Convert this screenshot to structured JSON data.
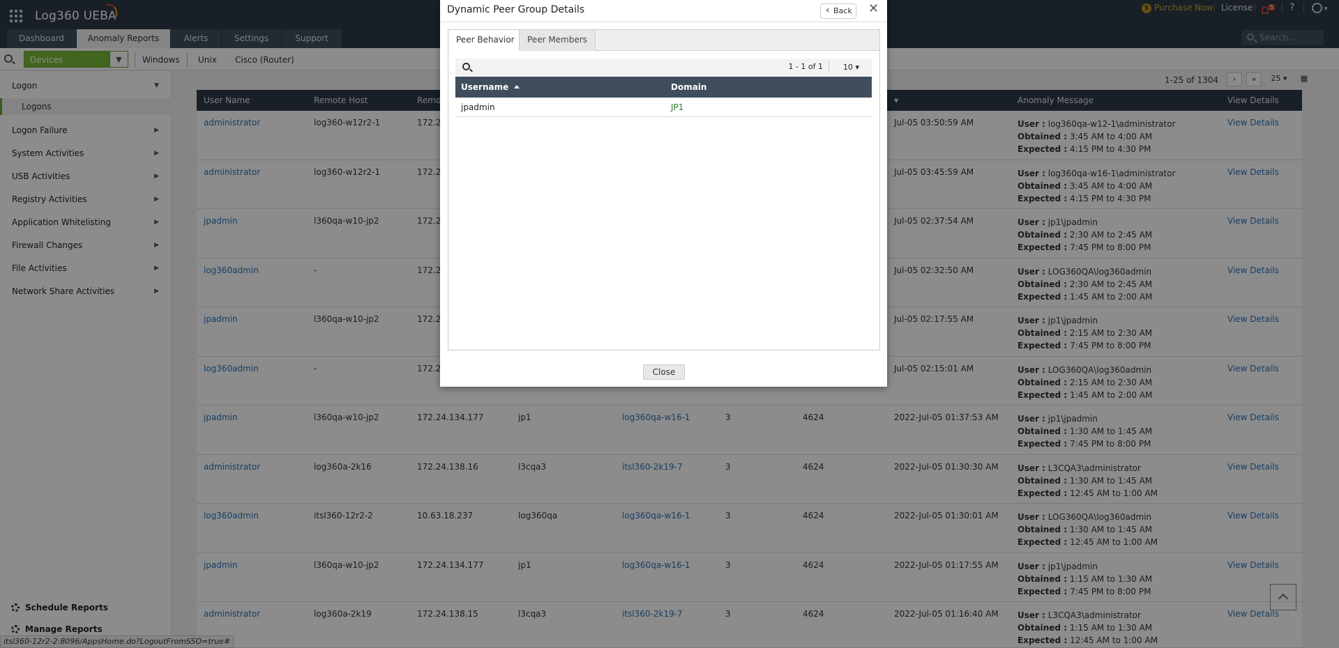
{
  "topbar": {
    "logo": "Log360 UEBA",
    "purchase": "Purchase Now",
    "license": "License",
    "notif_count": "5",
    "help": "?"
  },
  "tabs": [
    "Dashboard",
    "Anomaly Reports",
    "Alerts",
    "Settings",
    "Support"
  ],
  "search_placeholder": "Search...",
  "subbar": {
    "device_select": "Devices",
    "subtabs": [
      "Windows",
      "Unix",
      "Cisco (Router)"
    ]
  },
  "sidebar": {
    "groups": [
      {
        "label": "Logon",
        "sub": "Logons"
      },
      {
        "label": "Logon Failure"
      },
      {
        "label": "System Activities"
      },
      {
        "label": "USB Activities"
      },
      {
        "label": "Registry Activities"
      },
      {
        "label": "Application Whitelisting"
      },
      {
        "label": "Firewall Changes"
      },
      {
        "label": "File Activities"
      },
      {
        "label": "Network Share Activities"
      }
    ],
    "schedule": "Schedule Reports",
    "manage": "Manage Reports"
  },
  "table": {
    "pager": "1-25 of 1304",
    "page_size": "25",
    "headers": [
      "User Name",
      "Remote Host",
      "Remot",
      "Anomaly Message",
      "View Details"
    ],
    "rows": [
      {
        "user": "administrator",
        "host": "log360-w12r2-1",
        "ip": "172.2",
        "domain": "",
        "machine": "",
        "type": "",
        "event": "",
        "time": "Jul-05 03:50:59 AM",
        "msg_user": "log360qa-w12-1\\administrator",
        "obtained": "3:45 AM to 4:00 AM",
        "expected": "4:15 PM to 4:30 PM"
      },
      {
        "user": "administrator",
        "host": "log360-w12r2-1",
        "ip": "172.2",
        "domain": "",
        "machine": "",
        "type": "",
        "event": "",
        "time": "Jul-05 03:45:59 AM",
        "msg_user": "log360qa-w16-1\\administrator",
        "obtained": "3:45 AM to 4:00 AM",
        "expected": "4:15 PM to 4:30 PM"
      },
      {
        "user": "jpadmin",
        "host": "l360qa-w10-jp2",
        "ip": "172.2",
        "domain": "",
        "machine": "",
        "type": "",
        "event": "",
        "time": "Jul-05 02:37:54 AM",
        "msg_user": "jp1\\jpadmin",
        "obtained": "2:30 AM to 2:45 AM",
        "expected": "7:45 PM to 8:00 PM"
      },
      {
        "user": "log360admin",
        "host": "-",
        "ip": "172.2",
        "domain": "",
        "machine": "",
        "type": "",
        "event": "",
        "time": "Jul-05 02:32:50 AM",
        "msg_user": "LOG360QA\\log360admin",
        "obtained": "2:30 AM to 2:45 AM",
        "expected": "1:45 AM to 2:00 AM"
      },
      {
        "user": "jpadmin",
        "host": "l360qa-w10-jp2",
        "ip": "172.2",
        "domain": "",
        "machine": "",
        "type": "",
        "event": "",
        "time": "Jul-05 02:17:55 AM",
        "msg_user": "jp1\\jpadmin",
        "obtained": "2:15 AM to 2:30 AM",
        "expected": "7:45 PM to 8:00 PM"
      },
      {
        "user": "log360admin",
        "host": "-",
        "ip": "172.2",
        "domain": "",
        "machine": "",
        "type": "",
        "event": "",
        "time": "Jul-05 02:15:01 AM",
        "msg_user": "LOG360QA\\log360admin",
        "obtained": "2:15 AM to 2:30 AM",
        "expected": "1:45 AM to 2:00 AM"
      },
      {
        "user": "jpadmin",
        "host": "l360qa-w10-jp2",
        "ip": "172.24.134.177",
        "domain": "jp1",
        "machine": "log360qa-w16-1",
        "type": "3",
        "event": "4624",
        "time": "2022-Jul-05 01:37:53 AM",
        "msg_user": "jp1\\jpadmin",
        "obtained": "1:30 AM to 1:45 AM",
        "expected": "7:45 PM to 8:00 PM"
      },
      {
        "user": "administrator",
        "host": "log360a-2k16",
        "ip": "172.24.138.16",
        "domain": "l3cqa3",
        "machine": "itsl360-2k19-7",
        "type": "3",
        "event": "4624",
        "time": "2022-Jul-05 01:30:30 AM",
        "msg_user": "L3CQA3\\administrator",
        "obtained": "1:30 AM to 1:45 AM",
        "expected": "12:45 AM to 1:00 AM"
      },
      {
        "user": "log360admin",
        "host": "itsl360-12r2-2",
        "ip": "10.63.18.237",
        "domain": "log360qa",
        "machine": "log360qa-w16-1",
        "type": "3",
        "event": "4624",
        "time": "2022-Jul-05 01:30:01 AM",
        "msg_user": "LOG360QA\\log360admin",
        "obtained": "1:30 AM to 1:45 AM",
        "expected": "12:45 AM to 1:00 AM"
      },
      {
        "user": "jpadmin",
        "host": "l360qa-w10-jp2",
        "ip": "172.24.134.177",
        "domain": "jp1",
        "machine": "log360qa-w16-1",
        "type": "3",
        "event": "4624",
        "time": "2022-Jul-05 01:17:55 AM",
        "msg_user": "jp1\\jpadmin",
        "obtained": "1:15 AM to 1:30 AM",
        "expected": "7:45 PM to 8:00 PM"
      },
      {
        "user": "administrator",
        "host": "log360a-2k19",
        "ip": "172.24.138.15",
        "domain": "l3cqa3",
        "machine": "itsl360-2k19-7",
        "type": "3",
        "event": "4624",
        "time": "2022-Jul-05 01:16:40 AM",
        "msg_user": "L3CQA3\\administrator",
        "obtained": "1:15 AM to 1:30 AM",
        "expected": "12:45 AM to 1:00 AM"
      }
    ],
    "labels": {
      "user": "User :",
      "obtained": "Obtained :",
      "expected": "Expected :",
      "view": "View Details"
    }
  },
  "modal": {
    "title": "Dynamic Peer Group Details",
    "back": "Back",
    "tabs": [
      "Peer Behavior",
      "Peer Members"
    ],
    "count": "1 - 1 of 1",
    "per_page": "10",
    "columns": [
      "Username",
      "Domain"
    ],
    "rows": [
      {
        "username": "jpadmin",
        "domain": "JP1"
      }
    ],
    "close": "Close"
  },
  "statusbar": "itsl360-12r2-2:8096/AppsHome.do?LogoutFromSSO=true#"
}
